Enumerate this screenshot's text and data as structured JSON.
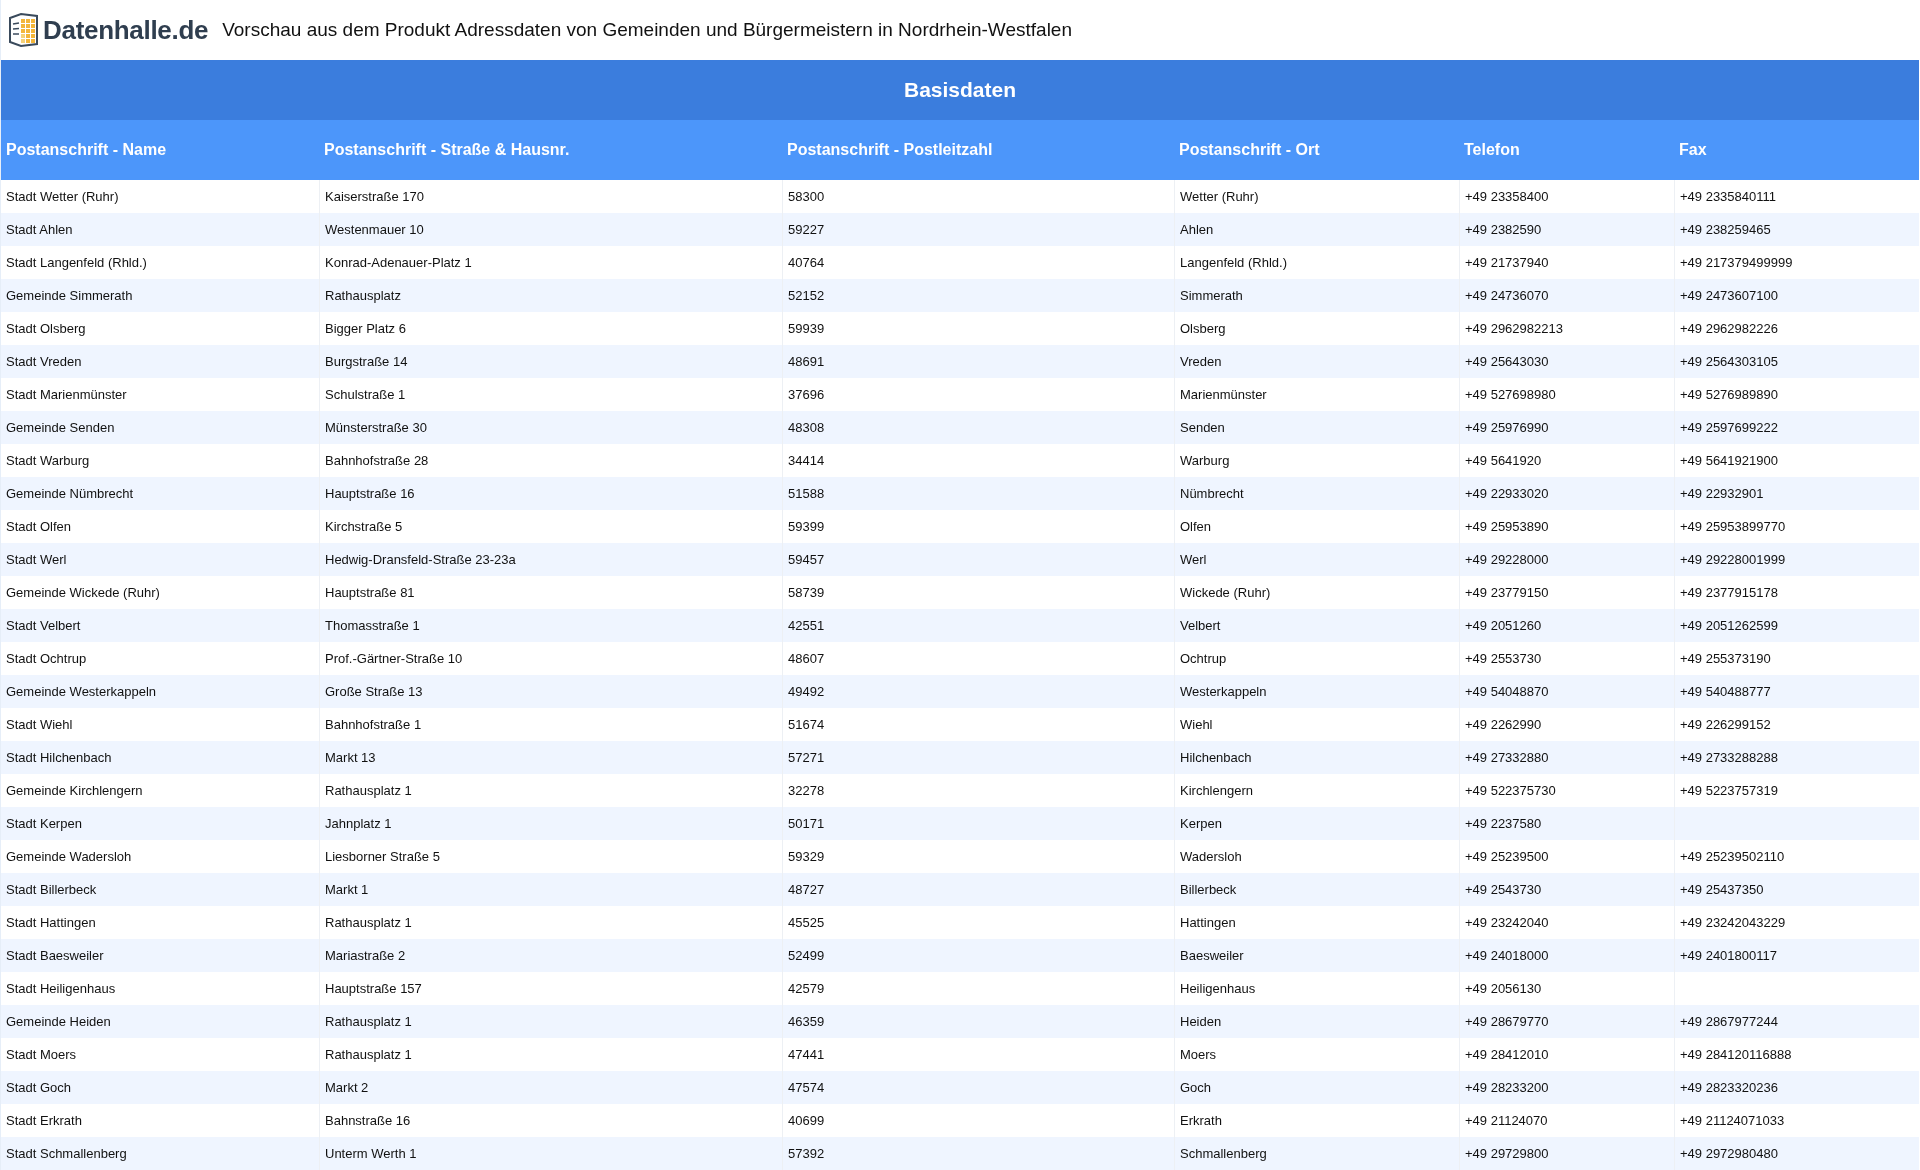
{
  "header": {
    "brand": "Datenhalle.de",
    "title": "Vorschau aus dem Produkt Adressdaten von Gemeinden und Bürgermeistern in Nordrhein-Westfalen"
  },
  "section_title": "Basisdaten",
  "table": {
    "columns": [
      "Postanschrift - Name",
      "Postanschrift - Straße & Hausnr.",
      "Postanschrift - Postleitzahl",
      "Postanschrift - Ort",
      "Telefon",
      "Fax"
    ],
    "rows": [
      [
        "Stadt Wetter (Ruhr)",
        "Kaiserstraße 170",
        "58300",
        "Wetter (Ruhr)",
        "+49 23358400",
        "+49 2335840111"
      ],
      [
        "Stadt Ahlen",
        "Westenmauer 10",
        "59227",
        "Ahlen",
        "+49 2382590",
        "+49 238259465"
      ],
      [
        "Stadt Langenfeld (Rhld.)",
        "Konrad-Adenauer-Platz 1",
        "40764",
        "Langenfeld (Rhld.)",
        "+49 21737940",
        "+49 217379499999"
      ],
      [
        "Gemeinde Simmerath",
        "Rathausplatz",
        "52152",
        "Simmerath",
        "+49 24736070",
        "+49 2473607100"
      ],
      [
        "Stadt Olsberg",
        "Bigger Platz 6",
        "59939",
        "Olsberg",
        "+49 2962982213",
        "+49 2962982226"
      ],
      [
        "Stadt Vreden",
        "Burgstraße 14",
        "48691",
        "Vreden",
        "+49 25643030",
        "+49 2564303105"
      ],
      [
        "Stadt Marienmünster",
        "Schulstraße 1",
        "37696",
        "Marienmünster",
        "+49 527698980",
        "+49 5276989890"
      ],
      [
        "Gemeinde Senden",
        "Münsterstraße 30",
        "48308",
        "Senden",
        "+49 25976990",
        "+49 2597699222"
      ],
      [
        "Stadt Warburg",
        "Bahnhofstraße 28",
        "34414",
        "Warburg",
        "+49 5641920",
        "+49 5641921900"
      ],
      [
        "Gemeinde Nümbrecht",
        "Hauptstraße 16",
        "51588",
        "Nümbrecht",
        "+49 22933020",
        "+49 22932901"
      ],
      [
        "Stadt Olfen",
        "Kirchstraße 5",
        "59399",
        "Olfen",
        "+49 25953890",
        "+49 25953899770"
      ],
      [
        "Stadt Werl",
        "Hedwig-Dransfeld-Straße 23-23a",
        "59457",
        "Werl",
        "+49 29228000",
        "+49 29228001999"
      ],
      [
        "Gemeinde Wickede (Ruhr)",
        "Hauptstraße 81",
        "58739",
        "Wickede (Ruhr)",
        "+49 23779150",
        "+49 2377915178"
      ],
      [
        "Stadt Velbert",
        "Thomasstraße 1",
        "42551",
        "Velbert",
        "+49 2051260",
        "+49 2051262599"
      ],
      [
        "Stadt Ochtrup",
        "Prof.-Gärtner-Straße 10",
        "48607",
        "Ochtrup",
        "+49 2553730",
        "+49 255373190"
      ],
      [
        "Gemeinde Westerkappeln",
        "Große Straße 13",
        "49492",
        "Westerkappeln",
        "+49 54048870",
        "+49 540488777"
      ],
      [
        "Stadt Wiehl",
        "Bahnhofstraße 1",
        "51674",
        "Wiehl",
        "+49 2262990",
        "+49 226299152"
      ],
      [
        "Stadt Hilchenbach",
        "Markt 13",
        "57271",
        "Hilchenbach",
        "+49 27332880",
        "+49 2733288288"
      ],
      [
        "Gemeinde Kirchlengern",
        "Rathausplatz 1",
        "32278",
        "Kirchlengern",
        "+49 522375730",
        "+49 5223757319"
      ],
      [
        "Stadt Kerpen",
        "Jahnplatz 1",
        "50171",
        "Kerpen",
        "+49 2237580",
        null
      ],
      [
        "Gemeinde Wadersloh",
        "Liesborner Straße 5",
        "59329",
        "Wadersloh",
        "+49 25239500",
        "+49 25239502110"
      ],
      [
        "Stadt Billerbeck",
        "Markt 1",
        "48727",
        "Billerbeck",
        "+49 2543730",
        "+49 25437350"
      ],
      [
        "Stadt Hattingen",
        "Rathausplatz 1",
        "45525",
        "Hattingen",
        "+49 23242040",
        "+49 23242043229"
      ],
      [
        "Stadt Baesweiler",
        "Mariastraße 2",
        "52499",
        "Baesweiler",
        "+49 24018000",
        "+49 2401800117"
      ],
      [
        "Stadt Heiligenhaus",
        "Hauptstraße 157",
        "42579",
        "Heiligenhaus",
        "+49 2056130",
        null
      ],
      [
        "Gemeinde Heiden",
        "Rathausplatz 1",
        "46359",
        "Heiden",
        "+49 28679770",
        "+49 2867977244"
      ],
      [
        "Stadt Moers",
        "Rathausplatz 1",
        "47441",
        "Moers",
        "+49 28412010",
        "+49 284120116888"
      ],
      [
        "Stadt Goch",
        "Markt 2",
        "47574",
        "Goch",
        "+49 28233200",
        "+49 2823320236"
      ],
      [
        "Stadt Erkrath",
        "Bahnstraße 16",
        "40699",
        "Erkrath",
        "+49 21124070",
        "+49 21124071033"
      ],
      [
        "Stadt Schmallenberg",
        "Unterm Werth 1",
        "57392",
        "Schmallenberg",
        "+49 29729800",
        "+49 2972980480"
      ]
    ]
  }
}
